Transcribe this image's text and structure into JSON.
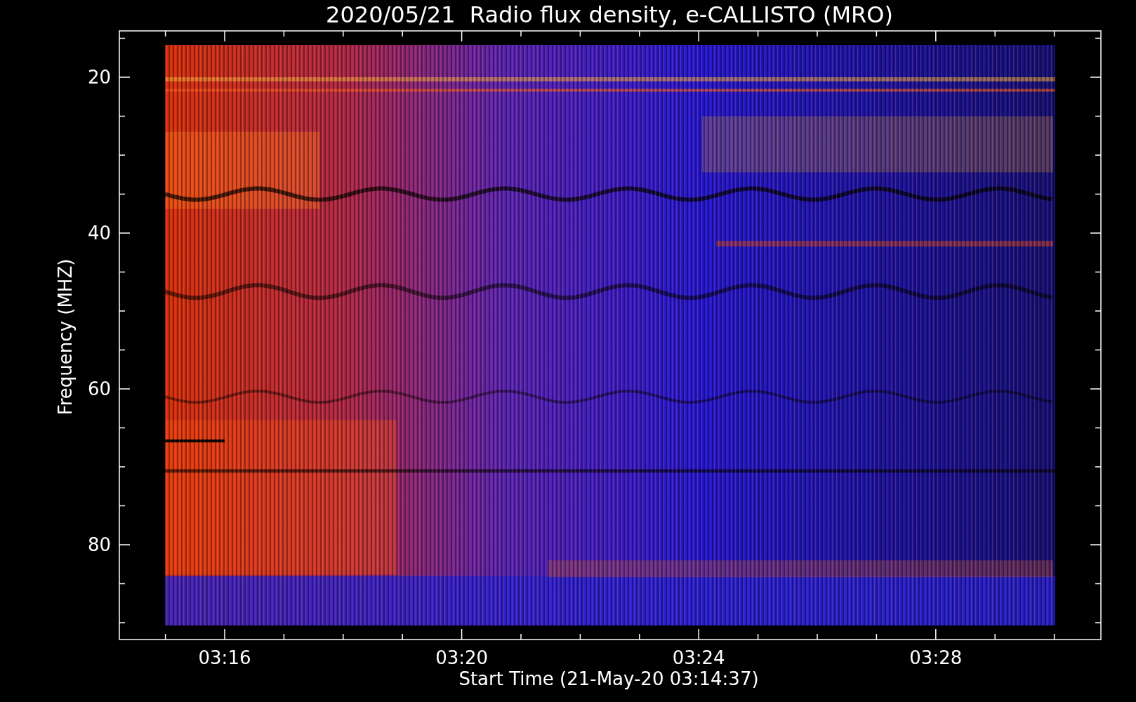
{
  "title": "2020/05/21  Radio flux density, e-CALLISTO (MRO)",
  "y_axis": {
    "label": "Frequency (MHZ)",
    "ticks": [
      "20",
      "40",
      "60",
      "80"
    ]
  },
  "x_axis": {
    "label": "Start Time (21-May-20 03:14:37)",
    "ticks": [
      "03:16",
      "03:20",
      "03:24",
      "03:28"
    ]
  }
}
